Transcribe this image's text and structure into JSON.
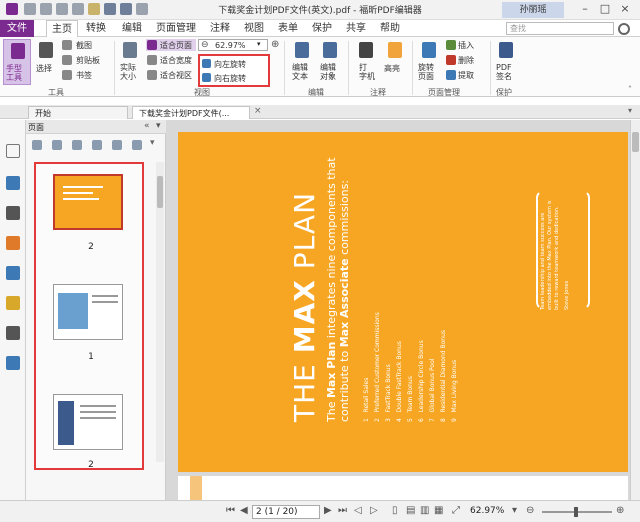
{
  "titlebar": {
    "title": "下载奖金计划PDF文件(英文).pdf - 福昕PDF编辑器",
    "user": "孙丽瑶"
  },
  "menubar": {
    "file": "文件",
    "tabs": [
      "主页",
      "转换",
      "编辑",
      "页面管理",
      "注释",
      "视图",
      "表单",
      "保护",
      "共享",
      "帮助"
    ],
    "search_placeholder": "查找"
  },
  "ribbon": {
    "hand_tool": "手型\n工具",
    "select": "选择",
    "screenshot": "截图",
    "clipboard": "剪贴板",
    "bookmark": "书签",
    "actual_size": "实际\n大小",
    "fit_page": "适合页面",
    "fit_width": "适合宽度",
    "fit_view": "适合视区",
    "zoom_value": "62.97%",
    "rotate_left": "向左旋转",
    "rotate_right": "向右旋转",
    "edit_text": "编辑\n文本",
    "edit_object": "编辑\n对象",
    "typewriter": "打\n字机",
    "highlight": "高亮",
    "rotate_page": "旋转\n页面",
    "insert": "插入",
    "delete": "删除",
    "extract": "提取",
    "pdf_sign": "PDF\n签名",
    "group_tools": "工具",
    "group_view": "视图",
    "group_edit": "编辑",
    "group_comment": "注释",
    "group_pages": "页面管理",
    "group_protect": "保护"
  },
  "tabs": {
    "start": "开始",
    "doc": "下载奖金计划PDF文件(..."
  },
  "panel": {
    "title": "页面",
    "thumbnails": [
      {
        "label": "2"
      },
      {
        "label": "1"
      },
      {
        "label": "2"
      }
    ]
  },
  "pdf": {
    "big_title_1": "THE",
    "big_title_2": "MAX",
    "big_title_3": "PLAN",
    "subtitle_1": "integrates nine components that",
    "subtitle_2": "contribute to",
    "subtitle_3": "commissions:",
    "max_plan": "Max Plan",
    "max_associate": "Max Associate",
    "list": [
      "Retail Sales",
      "Preferred Customer Commissions",
      "FastTrack Bonus",
      "Double FastTrack Bonus",
      "Team Bonus",
      "Leadership Circle Bonus",
      "Global Bonus Pool",
      "Residential Diamond Bonus",
      "Max Living Bonus"
    ],
    "quote": "Team leadership and team success are embedded into the Max Plan. Our system is built to reward teamwork and dedication.",
    "quote_author": "Steve Jones"
  },
  "statusbar": {
    "page_indicator": "2 (1 / 20)",
    "zoom": "62.97%"
  },
  "colors": {
    "accent": "#7b2a8f",
    "highlight_red": "#e23a3a",
    "page_orange": "#f6a623"
  }
}
